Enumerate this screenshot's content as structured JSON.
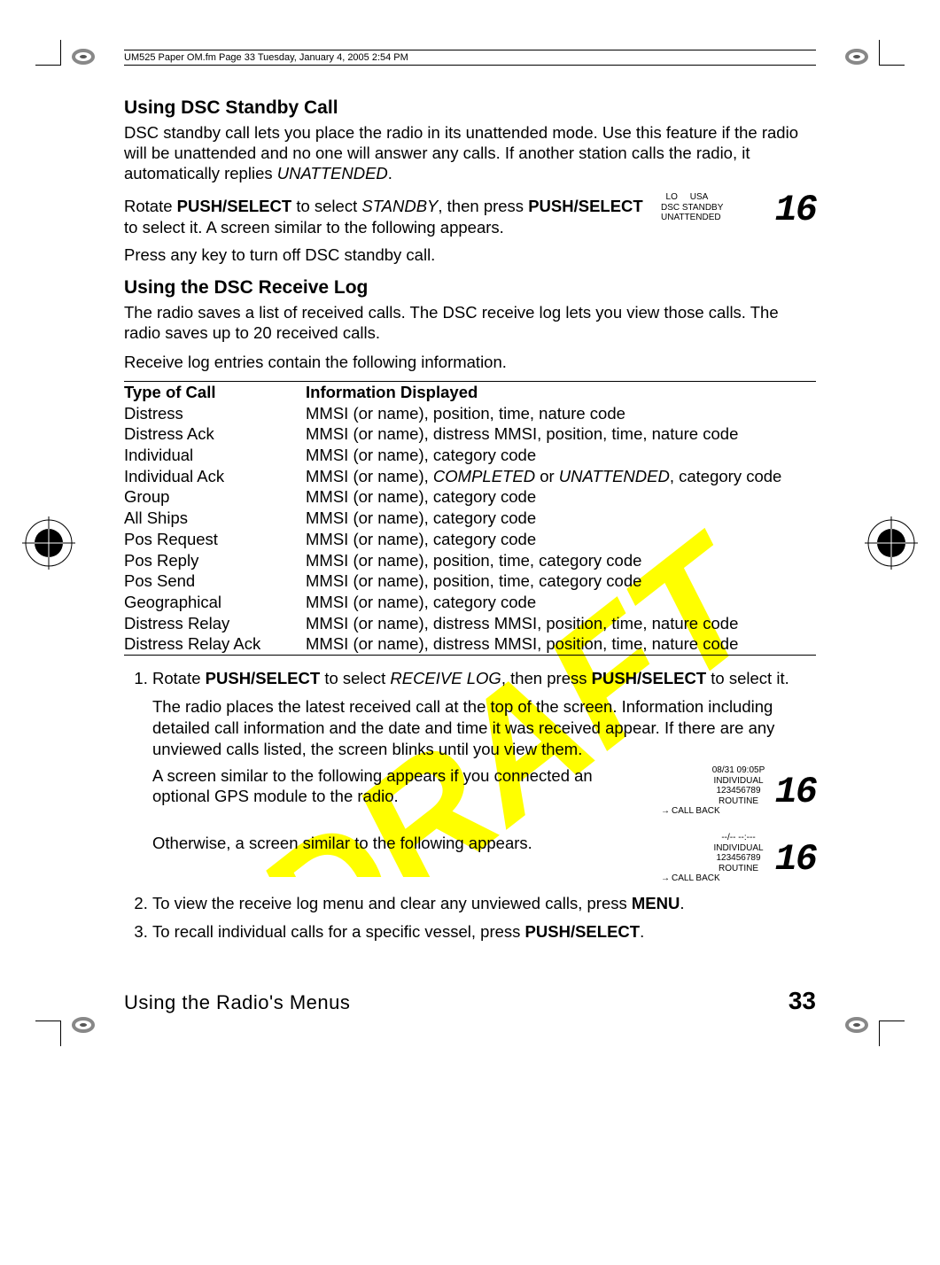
{
  "header_tag": "UM525 Paper OM.fm  Page 33  Tuesday, January 4, 2005  2:54 PM",
  "section1": {
    "title": "Using DSC Standby Call",
    "p1_a": "DSC standby call lets you place the radio in its unattended mode. Use this feature if the radio will be unattended and no one will answer any calls. If another station calls the radio, it automatically replies ",
    "p1_b": "UNATTENDED",
    "p1_c": ".",
    "p2_a": "Rotate ",
    "p2_b": "PUSH/SELECT",
    "p2_c": " to select ",
    "p2_d": "STANDBY",
    "p2_e": ", then press ",
    "p2_f": "PUSH/SELECT",
    "p2_g": " to select it. A screen similar to the following appears.",
    "p3": "Press any key to turn off DSC standby call."
  },
  "lcd1": {
    "l1": "  LO     USA",
    "l2": "",
    "l3": "DSC STANDBY",
    "l4": "UNATTENDED",
    "ch": "16"
  },
  "section2": {
    "title": "Using the DSC Receive Log",
    "p1": "The radio saves a list of received calls. The DSC receive log lets you view those calls. The radio saves up to 20 received calls.",
    "p2": "Receive log entries contain the following information."
  },
  "table": {
    "head_c1": "Type of Call",
    "head_c2": "Information Displayed",
    "rows": [
      {
        "c1": "Distress",
        "c2": "MMSI (or name), position, time, nature code"
      },
      {
        "c1": "Distress Ack",
        "c2": "MMSI (or name), distress MMSI, position, time, nature code"
      },
      {
        "c1": "Individual",
        "c2": "MMSI (or name), category code"
      },
      {
        "c1": "Individual Ack",
        "c2_a": "MMSI (or name), ",
        "c2_b": "COMPLETED",
        "c2_c": " or ",
        "c2_d": "UNATTENDED",
        "c2_e": ", category code"
      },
      {
        "c1": "Group",
        "c2": "MMSI (or name), category code"
      },
      {
        "c1": "All Ships",
        "c2": "MMSI (or name), category code"
      },
      {
        "c1": "Pos Request",
        "c2": "MMSI (or name), category code"
      },
      {
        "c1": "Pos Reply",
        "c2": "MMSI (or name), position, time, category code"
      },
      {
        "c1": "Pos Send",
        "c2": "MMSI (or name), position, time, category code"
      },
      {
        "c1": "Geographical",
        "c2": "MMSI (or name), category code"
      },
      {
        "c1": "Distress Relay",
        "c2": "MMSI (or name), distress MMSI, position, time, nature code"
      },
      {
        "c1": "Distress Relay Ack",
        "c2": "MMSI (or name), distress MMSI, position, time, nature code"
      }
    ]
  },
  "step1_a": "Rotate ",
  "step1_b": "PUSH/SELECT",
  "step1_c": " to select ",
  "step1_d": "RECEIVE LOG",
  "step1_e": ", then press ",
  "step1_f": "PUSH/SELECT",
  "step1_g": " to select it.",
  "step1_sub1": "The radio places the latest received call at the top of the screen. Information including detailed call information and the date and time it was received appear. If there are any unviewed calls listed, the screen blinks until you view them.",
  "step1_sub2": "A screen similar to the following appears if you connected an optional GPS module to the radio.",
  "step1_sub3": "Otherwise, a screen similar to the following appears.",
  "lcd2": {
    "l1": "08/31 09:05P",
    "l2": "INDIVIDUAL",
    "l3": "123456789",
    "l4": "ROUTINE",
    "l5": "CALL BACK",
    "ch": "16"
  },
  "lcd3": {
    "l1": "--/-- --:---",
    "l2": "INDIVIDUAL",
    "l3": "123456789",
    "l4": "ROUTINE",
    "l5": "CALL BACK",
    "ch": "16"
  },
  "step2_a": "To view the receive log menu and clear any unviewed calls, press ",
  "step2_b": "MENU",
  "step2_c": ".",
  "step3_a": "To recall individual calls for a specific vessel, press ",
  "step3_b": "PUSH/SELECT",
  "step3_c": ".",
  "footer": {
    "title": "Using the Radio's Menus",
    "page": "33"
  },
  "watermark": "DRAFT"
}
